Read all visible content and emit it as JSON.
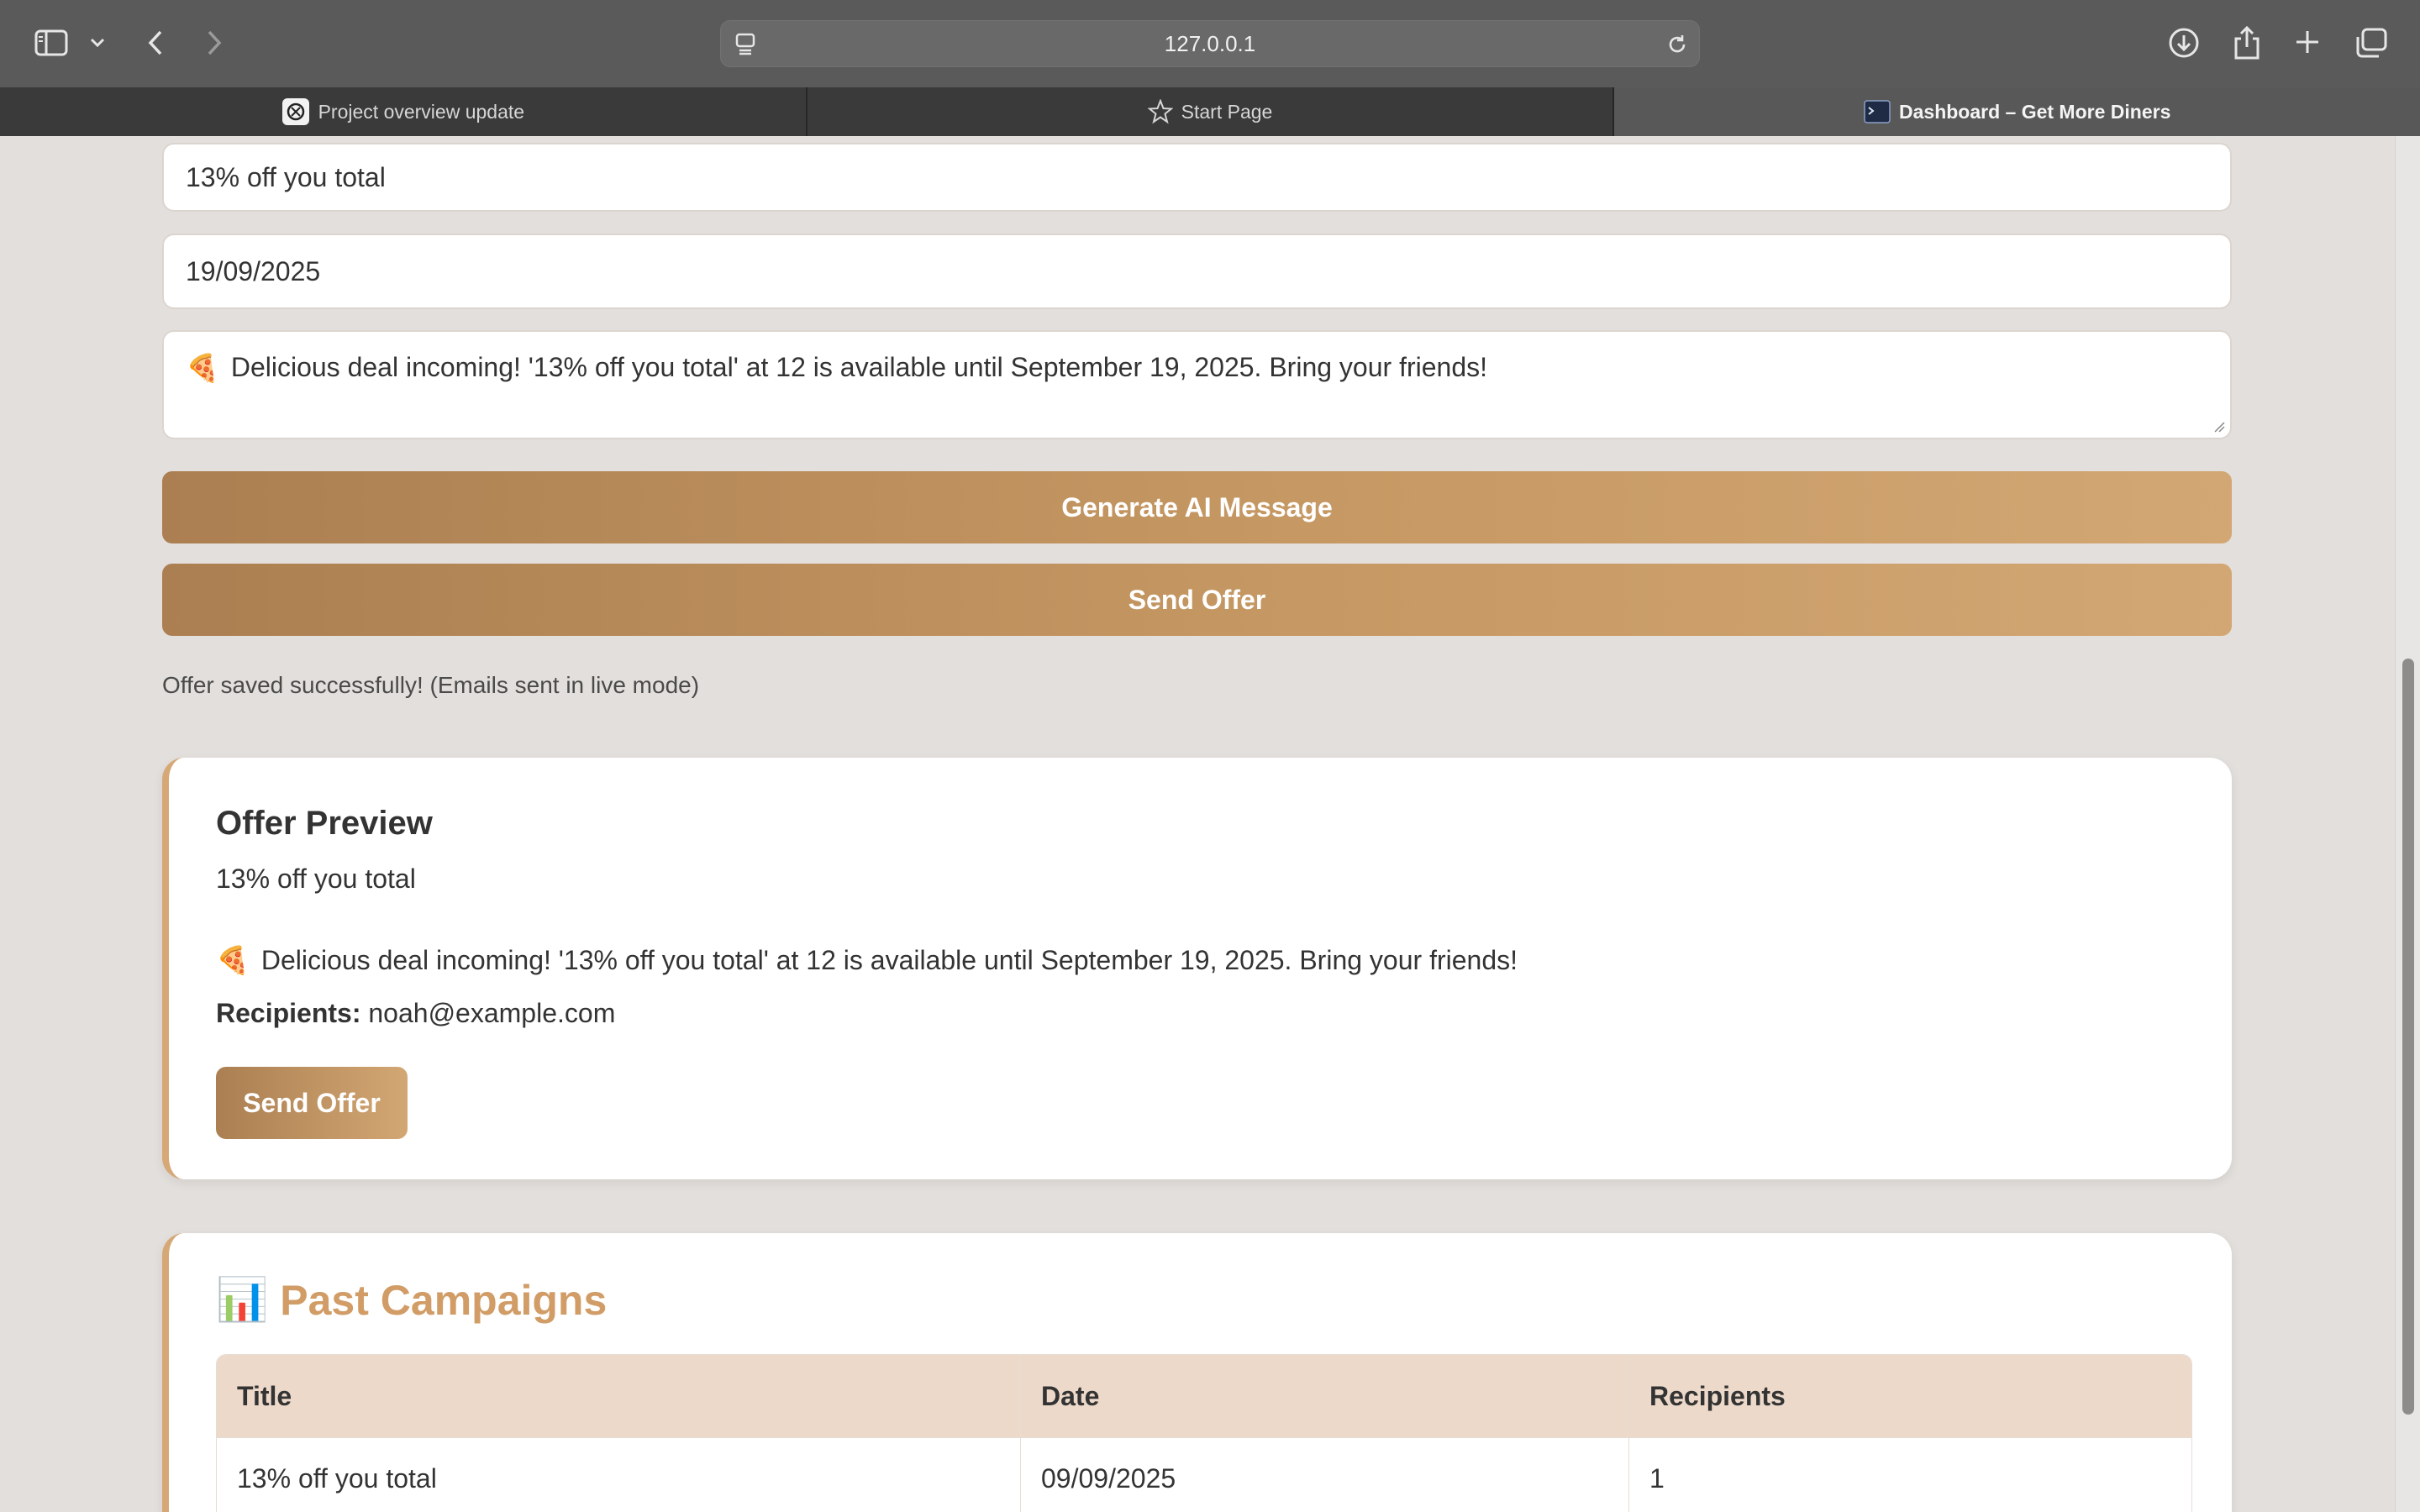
{
  "browser": {
    "url": "127.0.0.1",
    "tabs": [
      {
        "label": "Project overview update",
        "icon": "openai-icon",
        "active": false
      },
      {
        "label": "Start Page",
        "icon": "star-icon",
        "active": false
      },
      {
        "label": "Dashboard – Get More Diners",
        "icon": "terminal-icon",
        "active": true
      }
    ]
  },
  "form": {
    "title_value": "13% off you total",
    "date_value": "19/09/2025",
    "message_emoji": "🍕",
    "message_value": "Delicious deal incoming! '13% off you total' at 12 is available until September 19, 2025. Bring your friends!",
    "generate_label": "Generate AI Message",
    "send_label": "Send Offer",
    "status": "Offer saved successfully! (Emails sent in live mode)"
  },
  "preview": {
    "heading": "Offer Preview",
    "title": "13% off you total",
    "emoji": "🍕",
    "message": "Delicious deal incoming! '13% off you total' at 12 is available until September 19, 2025. Bring your friends!",
    "recipients_label": "Recipients:",
    "recipients_value": "noah@example.com",
    "send_label": "Send Offer"
  },
  "campaigns": {
    "emoji": "📊",
    "heading": "Past Campaigns",
    "columns": [
      "Title",
      "Date",
      "Recipients"
    ],
    "rows": [
      [
        "13% off you total",
        "09/09/2025",
        "1"
      ]
    ]
  },
  "colors": {
    "accent": "#d19c66",
    "button_start": "#ab7f51",
    "button_end": "#d2a773",
    "table_header": "#ecd9ca",
    "page_bg": "#e3dfdc"
  }
}
